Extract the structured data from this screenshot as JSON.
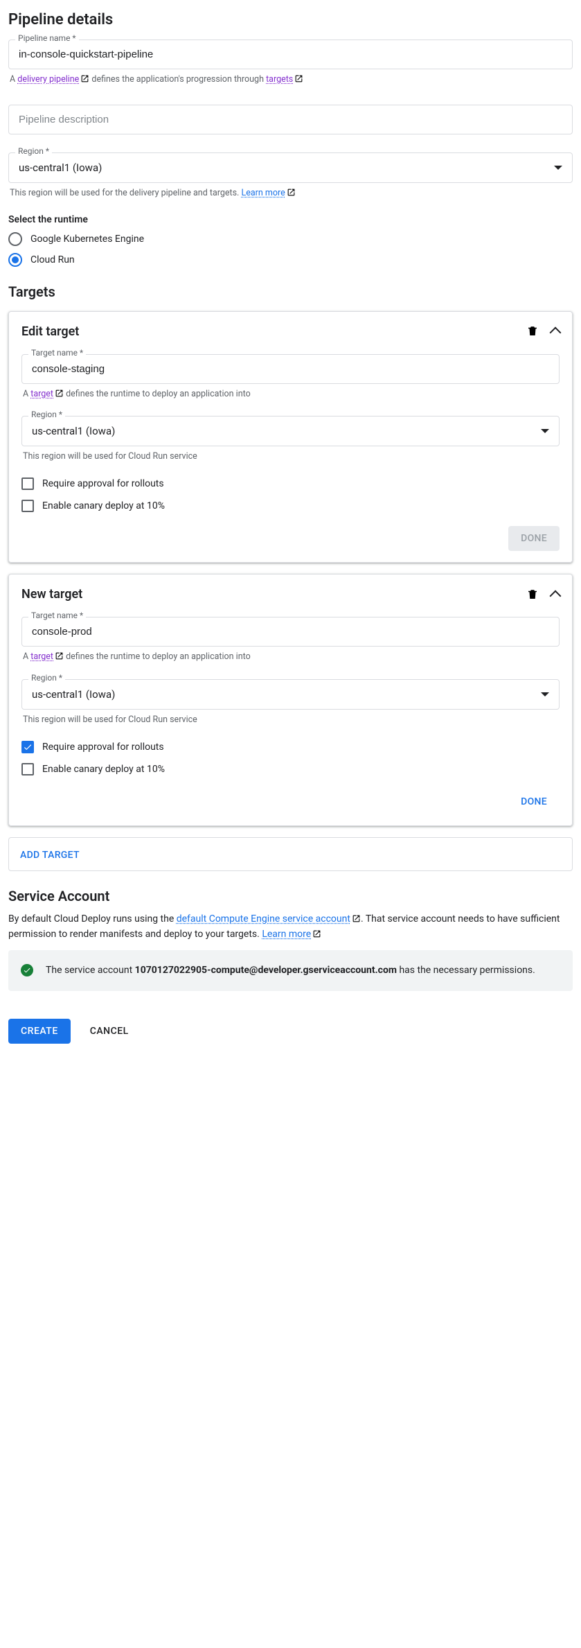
{
  "pipeline_details": {
    "heading": "Pipeline details",
    "name_label": "Pipeline name *",
    "name_value": "in-console-quickstart-pipeline",
    "name_helper_pre": "A ",
    "name_helper_link": "delivery pipeline",
    "name_helper_mid": " defines the application's progression through ",
    "name_helper_link2": "targets",
    "description_placeholder": "Pipeline description",
    "region_label": "Region *",
    "region_value": "us-central1 (Iowa)",
    "region_helper": "This region will be used for the delivery pipeline and targets. ",
    "region_learn_more": "Learn more"
  },
  "runtime": {
    "heading": "Select the runtime",
    "options": [
      {
        "label": "Google Kubernetes Engine",
        "checked": false
      },
      {
        "label": "Cloud Run",
        "checked": true
      }
    ]
  },
  "targets": {
    "heading": "Targets",
    "target_name_label": "Target name *",
    "target_helper_pre": "A ",
    "target_helper_link": "target",
    "target_helper_post": " defines the runtime to deploy an application into",
    "region_label": "Region *",
    "region_value": "us-central1 (Iowa)",
    "region_helper": "This region will be used for Cloud Run service",
    "approval_label": "Require approval for rollouts",
    "canary_label": "Enable canary deploy at 10%",
    "done_label": "DONE",
    "cards": [
      {
        "title": "Edit target",
        "name_value": "console-staging",
        "approval_checked": false,
        "canary_checked": false,
        "done_disabled": true
      },
      {
        "title": "New target",
        "name_value": "console-prod",
        "approval_checked": true,
        "canary_checked": false,
        "done_disabled": false
      }
    ],
    "add_target_label": "ADD TARGET"
  },
  "service_account": {
    "heading": "Service Account",
    "desc_pre": "By default Cloud Deploy runs using the ",
    "desc_link": "default Compute Engine service account",
    "desc_post": ". That service account needs to have sufficient permission to render manifests and deploy to your targets. ",
    "learn_more": "Learn more",
    "status_pre": "The service account ",
    "status_account": "1070127022905-compute@developer.gserviceaccount.com",
    "status_post": " has the necessary permissions."
  },
  "footer": {
    "create": "CREATE",
    "cancel": "CANCEL"
  }
}
